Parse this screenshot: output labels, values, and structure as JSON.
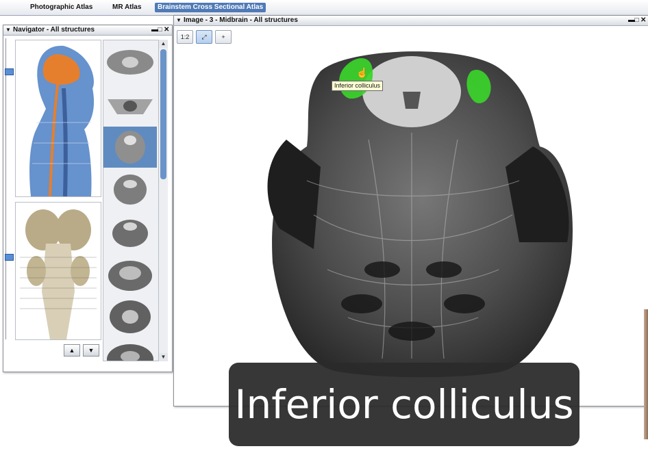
{
  "menu_tabs": [
    {
      "label": "Photographic Atlas"
    },
    {
      "label": "MR Atlas"
    },
    {
      "label": "Brainstem Cross Sectional Atlas"
    }
  ],
  "navigator": {
    "title": "Navigator - All structures",
    "win_buttons": [
      "▬",
      "□",
      "✕"
    ],
    "nav_up": "▲",
    "nav_down": "▼",
    "selected_thumbnail": 3
  },
  "image_window": {
    "title": "Image - 3 - Midbrain - All structures",
    "win_buttons": [
      "▬",
      "□",
      "✕"
    ],
    "tools": [
      {
        "label": "1:2",
        "icon": "zoom-ratio-icon"
      },
      {
        "label": "⤢",
        "icon": "fit-view-icon"
      },
      {
        "label": "+",
        "icon": "crosshair-icon"
      }
    ],
    "tooltip": "Inferior colliculus"
  },
  "caption": "Inferior colliculus",
  "colors": {
    "accent_tab": "#4f7ab6",
    "highlight_structure": "#39d42a",
    "selected_thumb": "#5f8bc0"
  }
}
